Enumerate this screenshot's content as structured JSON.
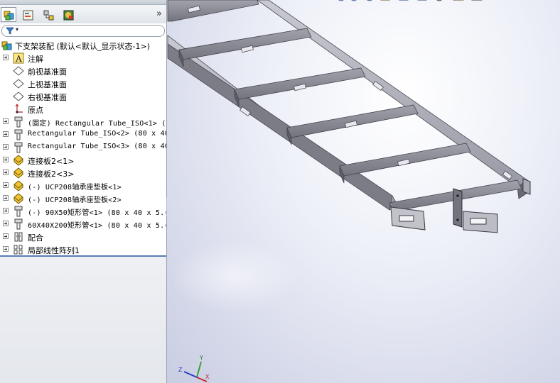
{
  "feature_tree": {
    "root_label": "下支架装配  (默认<默认_显示状态-1>)",
    "items": [
      {
        "label": "注解",
        "icon": "annotation-icon",
        "expandable": true
      },
      {
        "label": "前视基准面",
        "icon": "plane-icon",
        "expandable": false
      },
      {
        "label": "上视基准面",
        "icon": "plane-icon",
        "expandable": false
      },
      {
        "label": "右视基准面",
        "icon": "plane-icon",
        "expandable": false
      },
      {
        "label": "原点",
        "icon": "origin-icon",
        "expandable": false
      },
      {
        "label": "(固定) Rectangular Tube_ISO<1> (",
        "icon": "part-icon",
        "expandable": true
      },
      {
        "label": "Rectangular Tube_ISO<2> (80 x 40",
        "icon": "part-icon",
        "expandable": true
      },
      {
        "label": "Rectangular Tube_ISO<3> (80 x 40",
        "icon": "part-icon",
        "expandable": true
      },
      {
        "label": "连接板2<1>",
        "icon": "plate-part-icon",
        "expandable": true
      },
      {
        "label": "连接板2<3>",
        "icon": "plate-part-icon",
        "expandable": true
      },
      {
        "label": "(-) UCP208轴承座垫板<1>",
        "icon": "plate-part-icon",
        "expandable": true
      },
      {
        "label": "(-) UCP208轴承座垫板<2>",
        "icon": "plate-part-icon",
        "expandable": true
      },
      {
        "label": "(-) 90X50矩形管<1> (80 x 40 x 5.(",
        "icon": "part-icon",
        "expandable": true
      },
      {
        "label": "60X40X200矩形管<1> (80 x 40 x 5.(",
        "icon": "part-icon",
        "expandable": true
      },
      {
        "label": "配合",
        "icon": "mates-icon",
        "expandable": true
      },
      {
        "label": "局部线性阵列1",
        "icon": "pattern-icon",
        "expandable": true
      }
    ]
  },
  "tabs": [
    {
      "name": "featuremanager-tab",
      "icon": "assembly-tree-icon"
    },
    {
      "name": "propertymanager-tab",
      "icon": "property-icon"
    },
    {
      "name": "configurationmanager-tab",
      "icon": "configuration-icon"
    },
    {
      "name": "display-manager-tab",
      "icon": "display-icon"
    }
  ],
  "more_tabs_glyph": "»",
  "filter_glyph": "▾",
  "colors": {
    "tube_face": "#8a8a94",
    "tube_top": "#b8b8c0",
    "tube_dark": "#5e5e68",
    "selection_line": "#5a7db4"
  },
  "triad": {
    "x_label": "X",
    "y_label": "Y",
    "z_label": "Z"
  }
}
